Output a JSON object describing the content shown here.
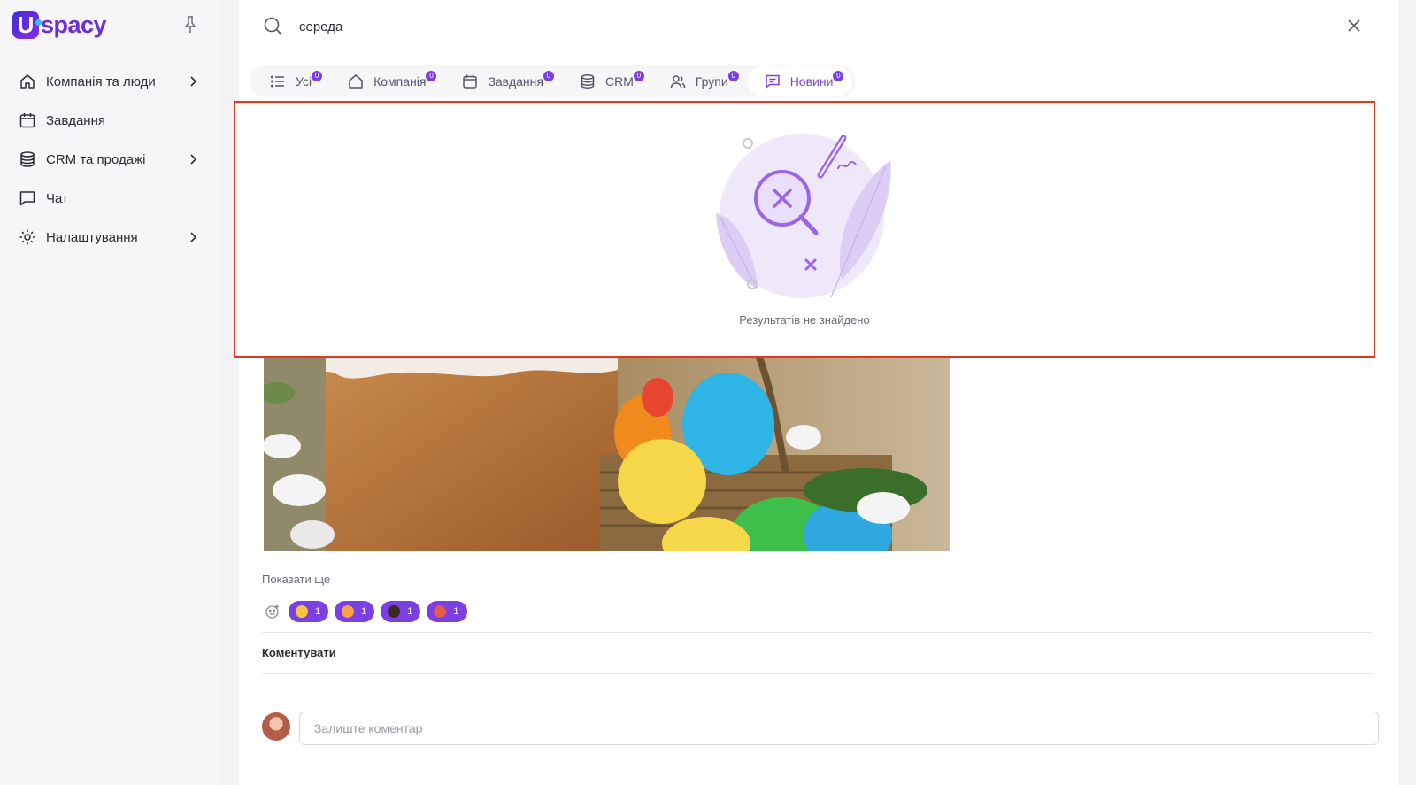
{
  "app": {
    "logo_text": "spacy",
    "logo_letter": "U"
  },
  "sidebar": {
    "items": [
      {
        "label": "Компанія та люди",
        "icon": "home-icon",
        "has_children": true
      },
      {
        "label": "Завдання",
        "icon": "calendar-icon",
        "has_children": false
      },
      {
        "label": "CRM та продажі",
        "icon": "database-icon",
        "has_children": true
      },
      {
        "label": "Чат",
        "icon": "chat-icon",
        "has_children": false
      },
      {
        "label": "Налаштування",
        "icon": "gear-icon",
        "has_children": true
      }
    ]
  },
  "search": {
    "value": "середа",
    "placeholder": ""
  },
  "tabs": [
    {
      "label": "Усі",
      "count": "0",
      "icon": "list-icon"
    },
    {
      "label": "Компанія",
      "count": "0",
      "icon": "home-icon"
    },
    {
      "label": "Завдання",
      "count": "0",
      "icon": "calendar-icon"
    },
    {
      "label": "CRM",
      "count": "0",
      "icon": "database-icon"
    },
    {
      "label": "Групи",
      "count": "0",
      "icon": "users-icon"
    },
    {
      "label": "Новини",
      "count": "0",
      "icon": "news-icon",
      "active": true
    }
  ],
  "empty_state": {
    "text": "Результатів не знайдено"
  },
  "post": {
    "show_more": "Показати ще",
    "reactions": [
      {
        "count": "1"
      },
      {
        "count": "1"
      },
      {
        "count": "1"
      },
      {
        "count": "1"
      }
    ],
    "comment_label": "Коментувати",
    "comment_placeholder": "Залиште коментар"
  },
  "colors": {
    "accent": "#7b3fe4",
    "highlight_border": "#e0391f"
  }
}
